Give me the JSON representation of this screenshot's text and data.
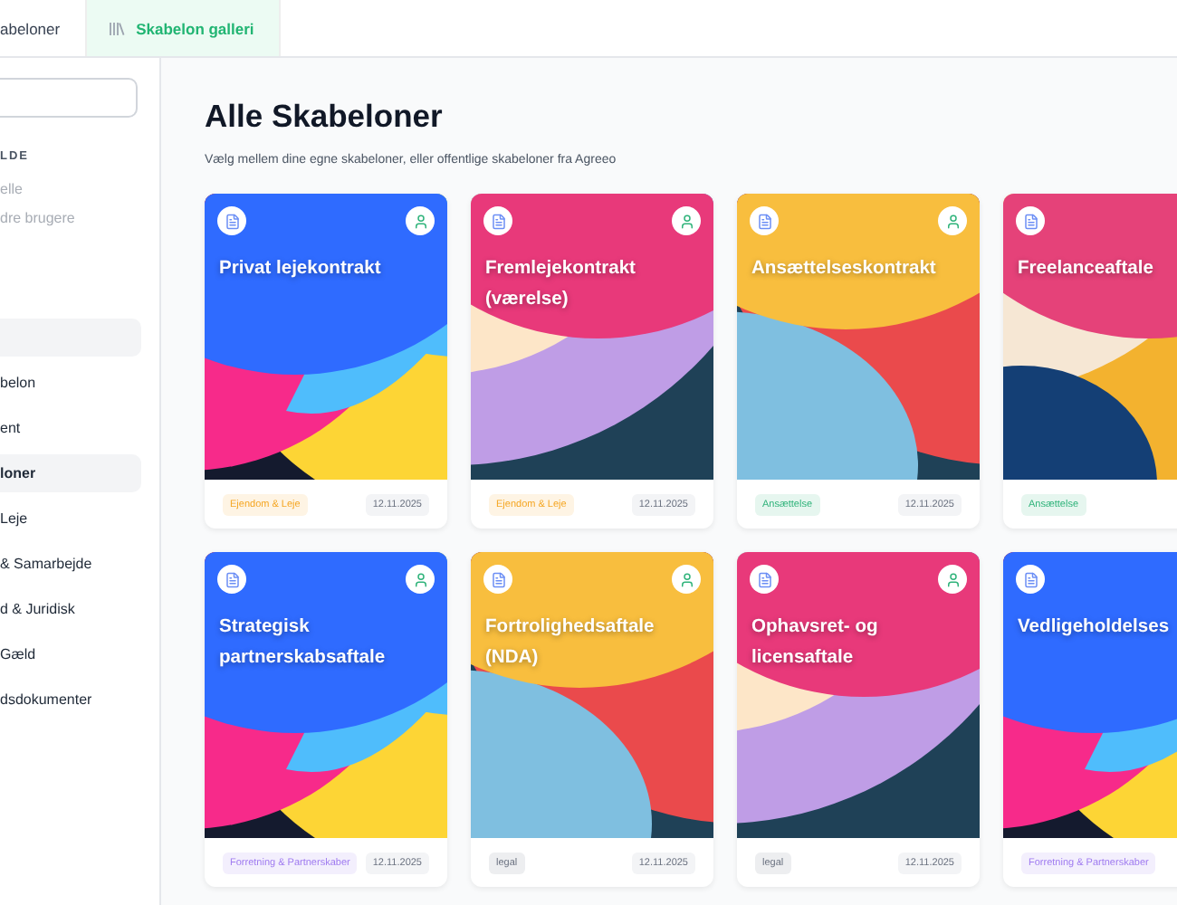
{
  "tabs": [
    {
      "label": "abeloner",
      "selected": false,
      "icon": false
    },
    {
      "label": "Skabelon galleri",
      "selected": true,
      "icon": true
    }
  ],
  "sidebar": {
    "heading": "LDE",
    "filters": [
      "elle",
      "dre brugere"
    ],
    "items": [
      {
        "selected": true
      },
      {
        "label": "belon",
        "selected": false
      },
      {
        "label": "ent",
        "selected": false
      },
      {
        "label": "loner",
        "selected": true
      },
      {
        "label": "Leje",
        "selected": false
      },
      {
        "label": "& Samarbejde",
        "selected": false
      },
      {
        "label": "d & Juridisk",
        "selected": false
      },
      {
        "label": "Gæld",
        "selected": false
      },
      {
        "label": "dsdokumenter",
        "selected": false
      }
    ]
  },
  "main": {
    "title": "Alle Skabeloner",
    "subtitle": "Vælg mellem dine egne skabeloner, eller offentlige skabeloner fra Agreeo"
  },
  "cards": [
    {
      "title": "Privat lejekontrakt",
      "kind": "blue",
      "tag": {
        "label": "Ejendom & Leje",
        "color": "#f5a623"
      },
      "date": "12.11.2025"
    },
    {
      "title": "Fremlejekontrakt (værelse)",
      "kind": "rose",
      "tag": {
        "label": "Ejendom & Leje",
        "color": "#f5a623"
      },
      "date": "12.11.2025"
    },
    {
      "title": "Ansættelseskontrakt",
      "kind": "amber",
      "tag": {
        "label": "Ansættelse",
        "color": "#2fb37a"
      },
      "date": "12.11.2025"
    },
    {
      "title": "Freelanceaftale",
      "kind": "peach",
      "tag": {
        "label": "Ansættelse",
        "color": "#2fb37a"
      }
    },
    {
      "title": "Strategisk partnerskabsaftale",
      "kind": "blue",
      "tag": {
        "label": "Forretning & Partnerskaber",
        "color": "#a07cf0"
      },
      "date": "12.11.2025"
    },
    {
      "title": "Fortrolighedsaftale (NDA)",
      "kind": "amber",
      "tag": {
        "label": "legal",
        "color": "#6b7280"
      },
      "date": "12.11.2025"
    },
    {
      "title": "Ophavsret- og licensaftale",
      "kind": "rose",
      "tag": {
        "label": "legal",
        "color": "#6b7280"
      },
      "date": "12.11.2025"
    },
    {
      "title": "Vedligeholdelses",
      "kind": "blue",
      "tag": {
        "label": "Forretning & Partnerskaber",
        "color": "#a07cf0"
      }
    }
  ]
}
